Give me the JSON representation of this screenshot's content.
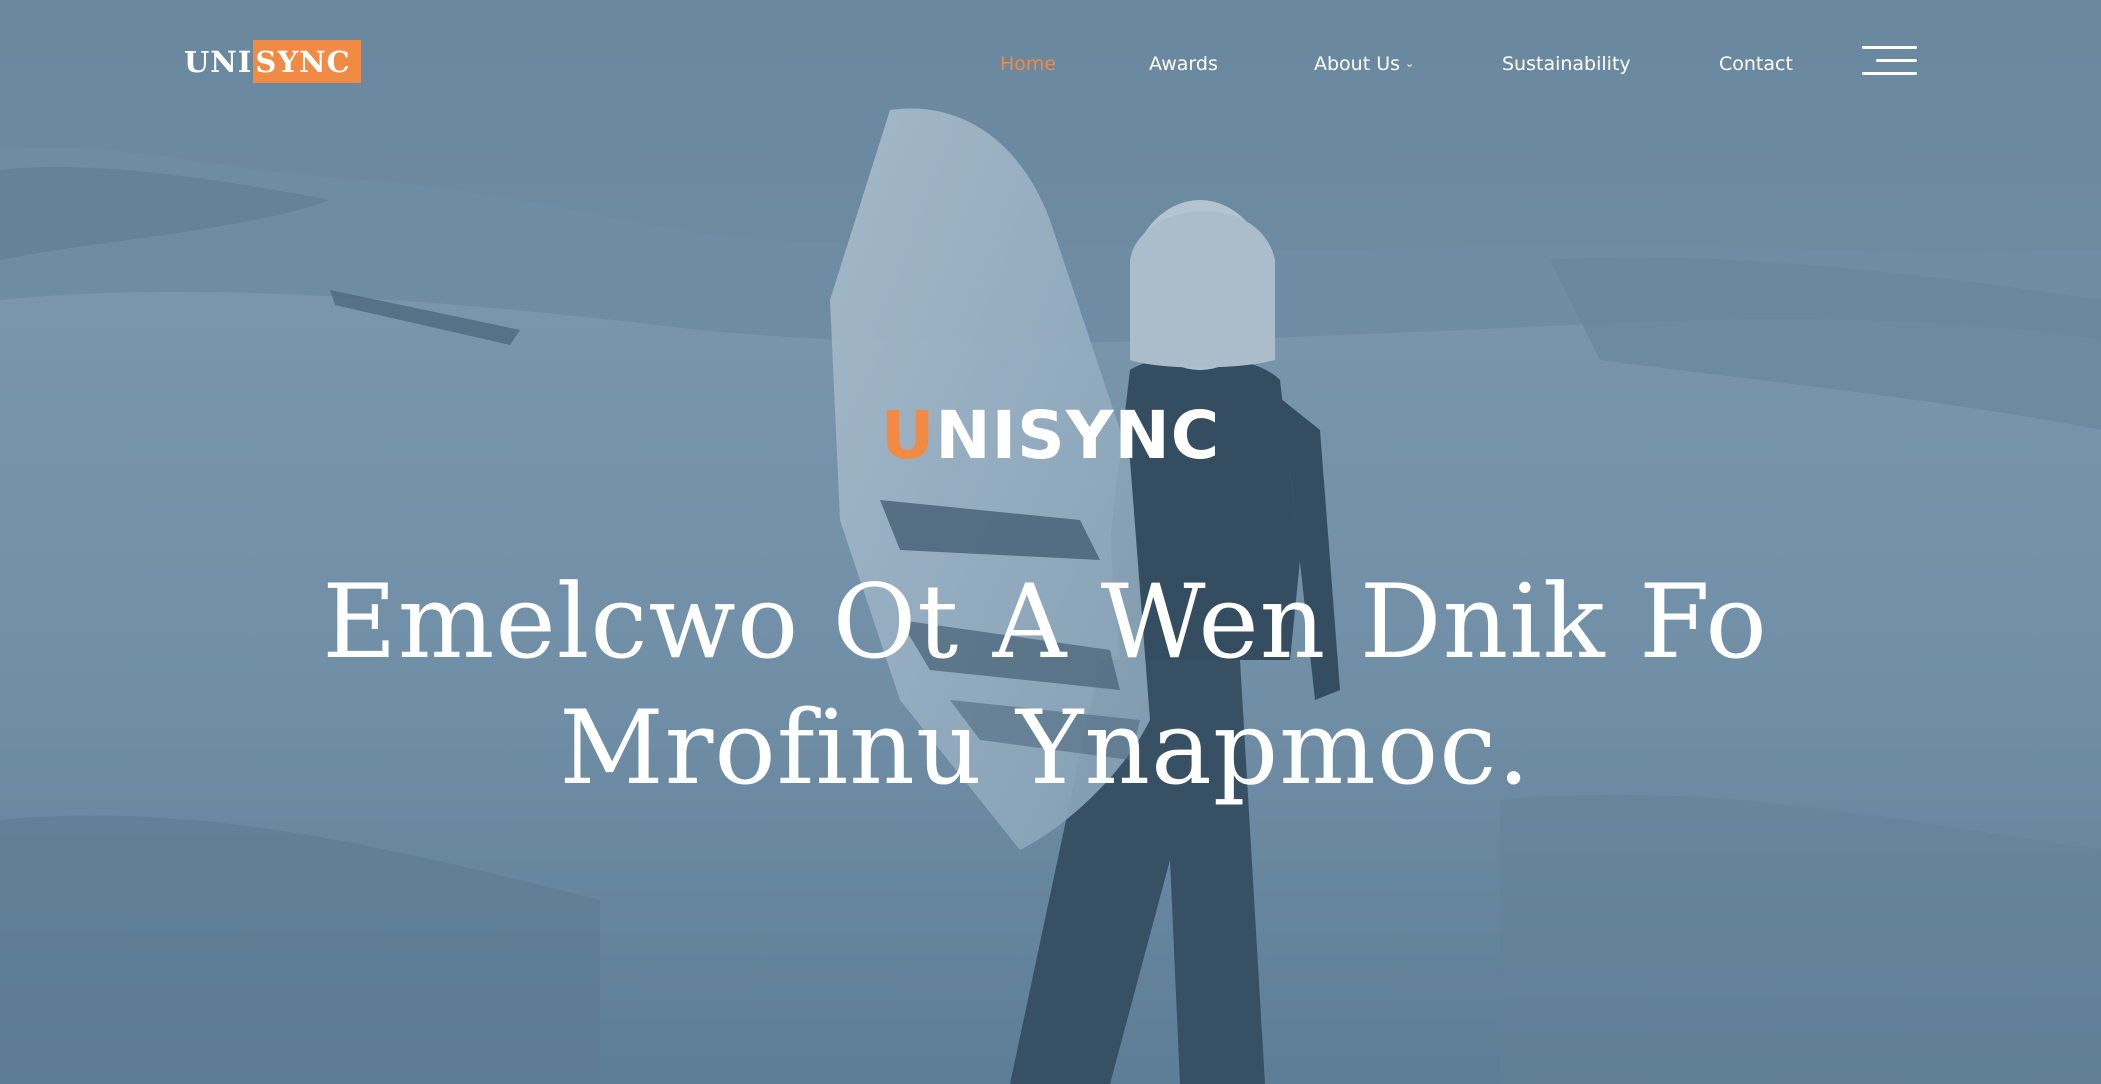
{
  "header": {
    "logo": {
      "part1": "UNI",
      "part2": "SYNC"
    },
    "nav": [
      {
        "label": "Home",
        "active": true
      },
      {
        "label": "Awards",
        "active": false
      },
      {
        "label": "About Us",
        "active": false,
        "has_dropdown": true
      },
      {
        "label": "Sustainability",
        "active": false
      },
      {
        "label": "Contact",
        "active": false
      }
    ],
    "menu_icon": "hamburger-menu-icon"
  },
  "hero": {
    "brand_first_letter": "U",
    "brand_rest": "NISYNC",
    "headline_line1": "Emelcwo Ot A Wen Dnik Fo",
    "headline_line2": "Mrofinu Ynapmoc."
  },
  "colors": {
    "accent": "#f08a45",
    "text": "#ffffff",
    "overlay": "#5f7f98"
  }
}
